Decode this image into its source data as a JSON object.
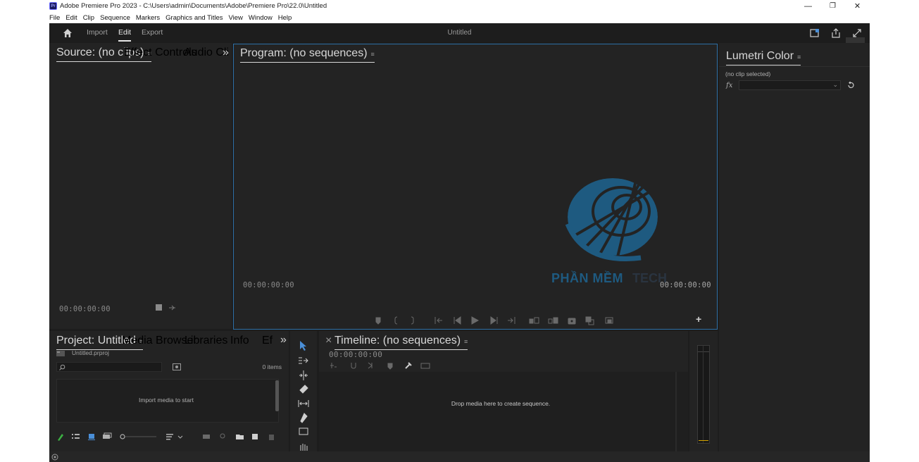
{
  "window": {
    "title": "Adobe Premiere Pro 2023 - C:\\Users\\admin\\Documents\\Adobe\\Premiere Pro\\22.0\\Untitled",
    "app_icon_text": "Pr",
    "minimize": "—",
    "restore": "❐",
    "close": "✕"
  },
  "menu": [
    "File",
    "Edit",
    "Clip",
    "Sequence",
    "Markers",
    "Graphics and Titles",
    "View",
    "Window",
    "Help"
  ],
  "header": {
    "tabs": {
      "import": "Import",
      "edit": "Edit",
      "export": "Export"
    },
    "title": "Untitled"
  },
  "source": {
    "tabs": {
      "source": "Source: (no clips)",
      "effect_controls": "Effect Controls",
      "audio_clip": "Audio Cli"
    },
    "overflow": "»",
    "timecode": "00:00:00:00"
  },
  "program": {
    "tab": "Program: (no sequences)",
    "timecode_left": "00:00:00:00",
    "timecode_right": "00:00:00:00",
    "watermark_text": "PHẦN MỀM"
  },
  "lumetri": {
    "tab": "Lumetri Color",
    "no_clip": "(no clip selected)",
    "fx": "fx"
  },
  "project": {
    "tabs": {
      "project": "Project: Untitled",
      "media_browser": "Media Browser",
      "libraries": "Libraries",
      "info": "Info",
      "effects": "Ef"
    },
    "overflow": "»",
    "file": "Untitled.prproj",
    "item_count": "0 items",
    "import_hint": "Import media to start"
  },
  "timeline": {
    "close": "×",
    "tab": "Timeline: (no sequences)",
    "timecode": "00:00:00:00",
    "drop_hint": "Drop media here to create sequence."
  },
  "menu_glyph": "≡",
  "colors": {
    "accent_blue": "#2d6fa6",
    "panel": "#232323",
    "background": "#1d1d1d"
  }
}
